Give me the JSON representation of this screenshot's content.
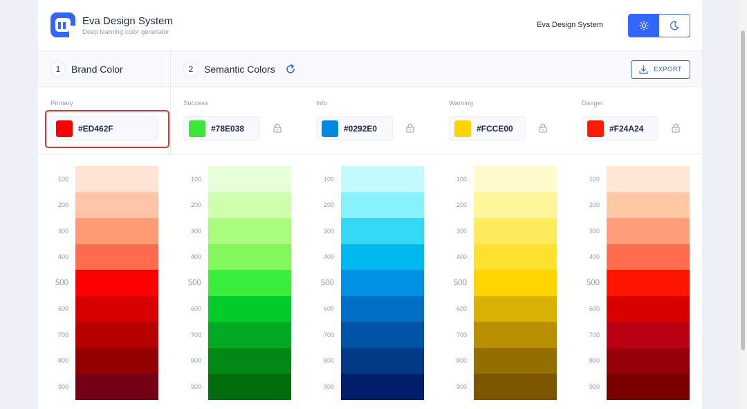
{
  "header": {
    "title": "Eva Design System",
    "subtitle": "Deep learning color generator",
    "link_label": "Eva Design System",
    "theme_light_icon": "sun-icon",
    "theme_dark_icon": "moon-icon"
  },
  "sections": {
    "brand": {
      "number": "1",
      "title": "Brand Color"
    },
    "semantic": {
      "number": "2",
      "title": "Semantic Colors"
    },
    "export_label": "EXPORT"
  },
  "colors": [
    {
      "name": "Primary",
      "hex": "#ED462F",
      "swatch": "#ff0000",
      "shades": [
        "#ffe4d5",
        "#ffc4a5",
        "#ff9b74",
        "#ff6b4d",
        "#ff0000",
        "#d80000",
        "#b60000",
        "#930000",
        "#750015"
      ]
    },
    {
      "name": "Success",
      "hex": "#78E038",
      "swatch": "#3ce73c",
      "shades": [
        "#e6ffd6",
        "#ceffad",
        "#a9fc7e",
        "#84f75d",
        "#3cee3c",
        "#00cc2b",
        "#00aa22",
        "#008714",
        "#006e0d"
      ]
    },
    {
      "name": "Info",
      "hex": "#0292E0",
      "swatch": "#0288e0",
      "shades": [
        "#c3fbfd",
        "#86f1fb",
        "#35d8f5",
        "#00b8ee",
        "#0290e3",
        "#006fc4",
        "#0054a5",
        "#003a86",
        "#001e6a"
      ]
    },
    {
      "name": "Warning",
      "hex": "#FCCE00",
      "swatch": "#ffd500",
      "shades": [
        "#fffbcc",
        "#fff599",
        "#ffec5c",
        "#ffe22e",
        "#ffd400",
        "#dbb100",
        "#b78f00",
        "#936f00",
        "#7a5700"
      ]
    },
    {
      "name": "Danger",
      "hex": "#F24A24",
      "swatch": "#ff1a00",
      "shades": [
        "#ffe7d6",
        "#ffc8a5",
        "#ff9e78",
        "#ff6d4c",
        "#ff1400",
        "#db0000",
        "#b90012",
        "#960008",
        "#7a0000"
      ]
    }
  ],
  "shade_labels": [
    "100",
    "200",
    "300",
    "400",
    "500",
    "600",
    "700",
    "800",
    "900"
  ],
  "accent": "#3366ff",
  "highlight_color": "#e03030"
}
